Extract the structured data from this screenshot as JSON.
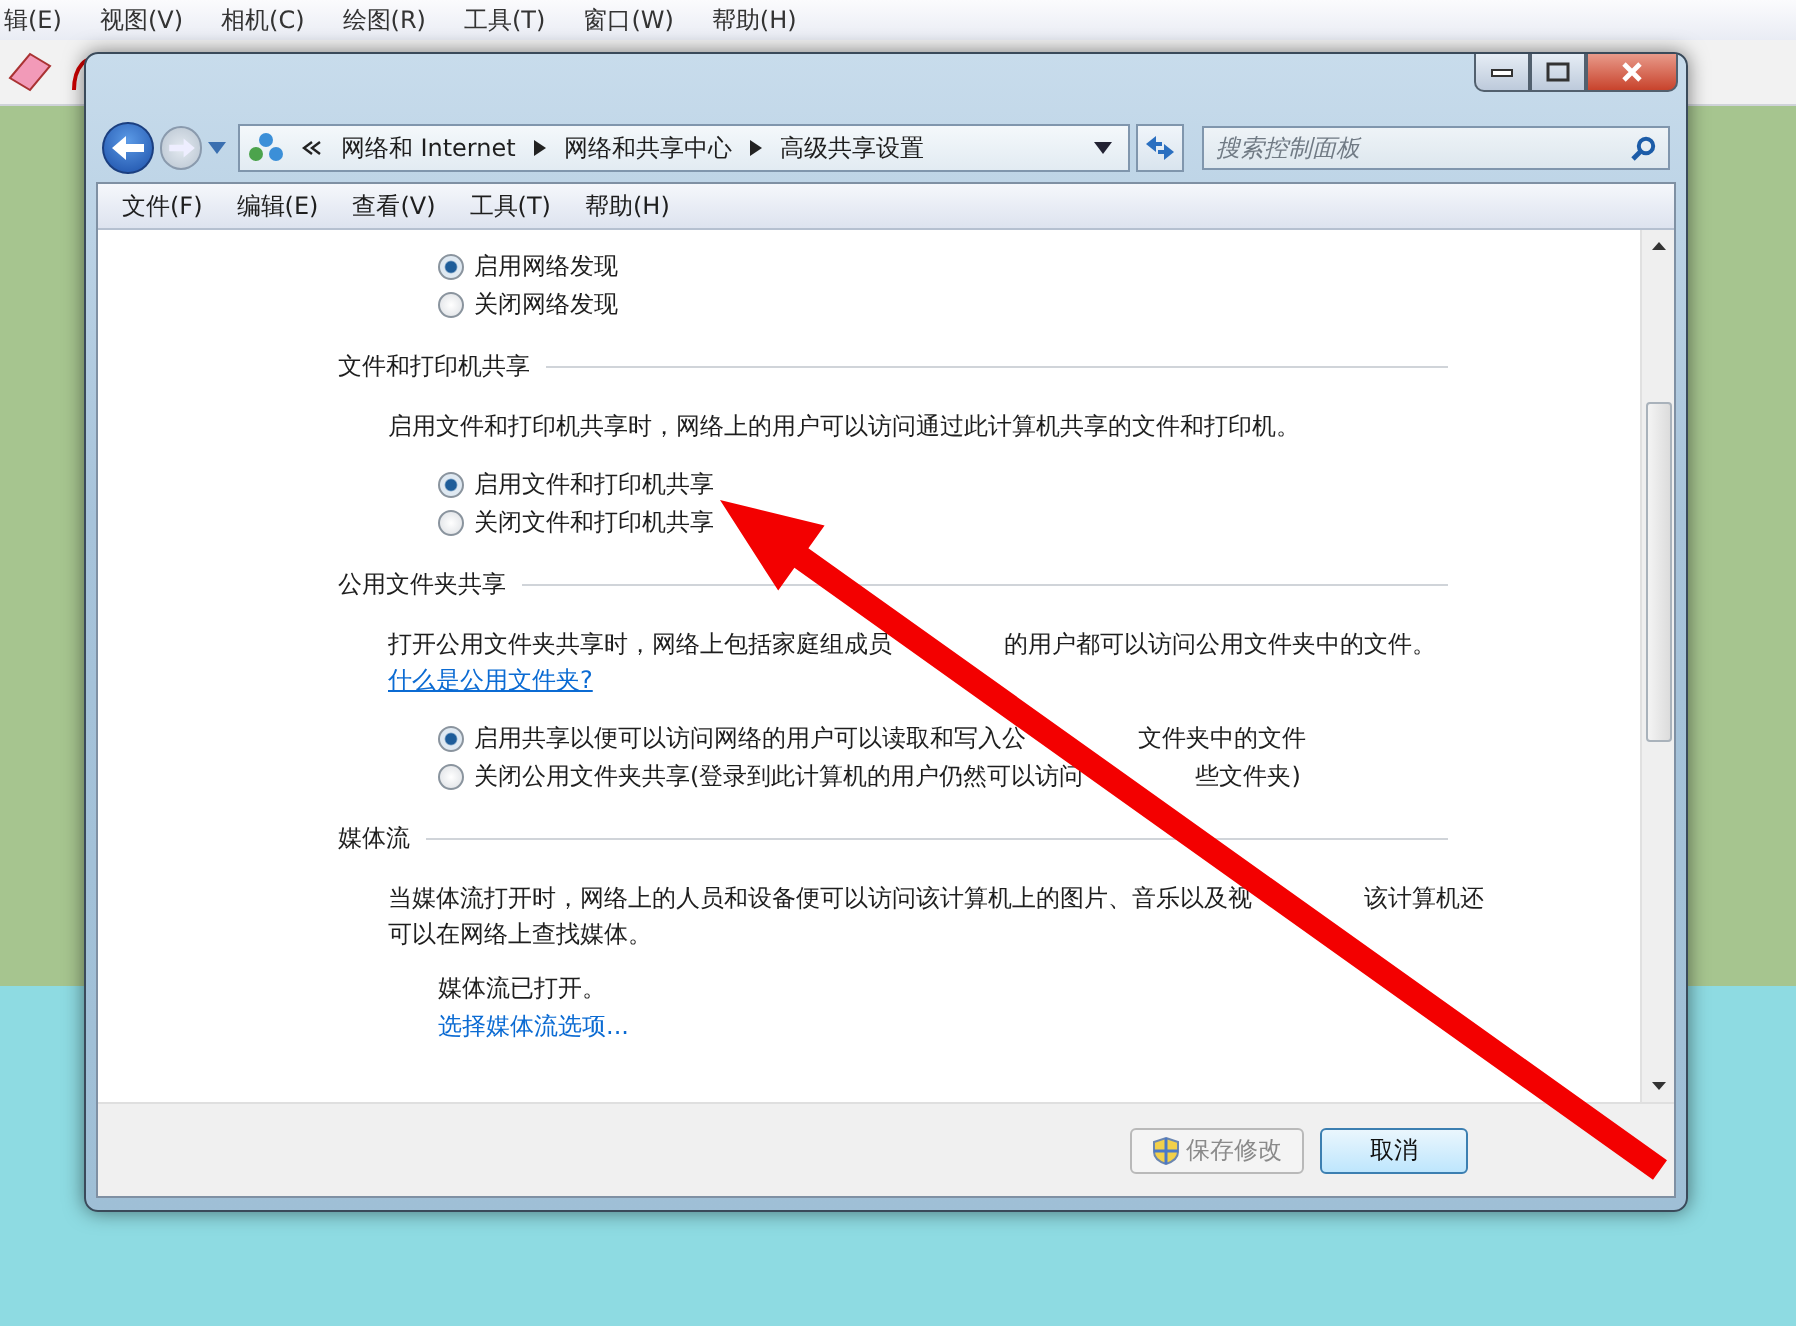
{
  "app_menu": [
    "辑(E)",
    "视图(V)",
    "相机(C)",
    "绘图(R)",
    "工具(T)",
    "窗口(W)",
    "帮助(H)"
  ],
  "dialog": {
    "address": {
      "breadcrumb": [
        "网络和 Internet",
        "网络和共享中心",
        "高级共享设置"
      ]
    },
    "search": {
      "placeholder": "搜索控制面板"
    },
    "menu": [
      "文件(F)",
      "编辑(E)",
      "查看(V)",
      "工具(T)",
      "帮助(H)"
    ],
    "sections": [
      {
        "options": [
          {
            "label": [
              "启用网络发现"
            ],
            "selected": true
          },
          {
            "label": [
              "关闭网络发现"
            ],
            "selected": false
          }
        ]
      },
      {
        "title": "文件和打印机共享",
        "description": [
          [
            "启用文件和打印机共享时，网络上的用户可以访问通过此计算机共享的文件和打印机。"
          ]
        ],
        "options": [
          {
            "label": [
              "启用文件和打印机共享"
            ],
            "selected": true
          },
          {
            "label": [
              "关闭文件和打印机共享"
            ],
            "selected": false
          }
        ]
      },
      {
        "title": "公用文件夹共享",
        "description": [
          [
            "打开公用文件夹共享时，网络上包括家庭组成员",
            "的用户都可以访问公用文件夹中的文件。"
          ]
        ],
        "link": "什么是公用文件夹?",
        "options": [
          {
            "label": [
              "启用共享以便可以访问网络的用户可以读取和写入公",
              "文件夹中的文件"
            ],
            "selected": true
          },
          {
            "label": [
              "关闭公用文件夹共享(登录到此计算机的用户仍然可以访问",
              "些文件夹)"
            ],
            "selected": false
          }
        ]
      },
      {
        "title": "媒体流",
        "description": [
          [
            "当媒体流打开时，网络上的人员和设备便可以访问该计算机上的图片、音乐以及视",
            "该计算机还"
          ],
          [
            "可以在网络上查找媒体。"
          ]
        ],
        "status": "媒体流已打开。",
        "action": "选择媒体流选项..."
      }
    ],
    "buttons": [
      {
        "label": "保存修改",
        "kind": "admin",
        "disabled": true
      },
      {
        "label": "取消",
        "kind": "plain",
        "disabled": false
      }
    ]
  }
}
